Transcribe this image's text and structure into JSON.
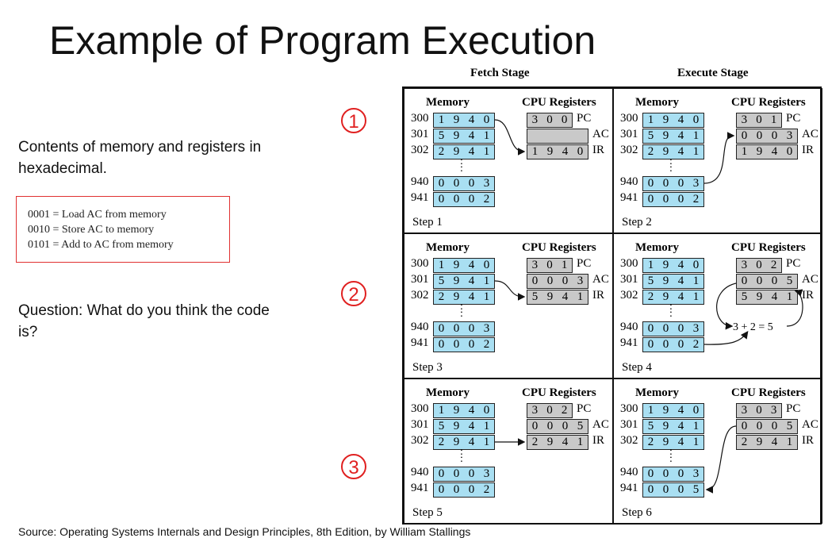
{
  "title": "Example of Program Execution",
  "left": {
    "description": "Contents of memory and registers in hexadecimal.",
    "opcodes": [
      "0001 = Load AC from memory",
      "0010 = Store AC to memory",
      "0101 = Add to AC from memory"
    ],
    "question": "Question: What do you think the code is?"
  },
  "markers": [
    "1",
    "2",
    "3"
  ],
  "marker_color": "#e02020",
  "stages": {
    "fetch": "Fetch Stage",
    "execute": "Execute Stage"
  },
  "labels": {
    "memory": "Memory",
    "cpu": "CPU Registers",
    "pc": "PC",
    "ac": "AC",
    "ir": "IR",
    "dots": ":"
  },
  "colors": {
    "memory": "#a9dff2",
    "register": "#c9c9c9"
  },
  "steps": [
    {
      "label": "Step 1",
      "mem": [
        [
          "300",
          "1940"
        ],
        [
          "301",
          "5941"
        ],
        [
          "302",
          "2941"
        ],
        [
          "940",
          "0003"
        ],
        [
          "941",
          "0002"
        ]
      ],
      "pc": "300",
      "ac": "",
      "ir": "1940"
    },
    {
      "label": "Step 2",
      "mem": [
        [
          "300",
          "1940"
        ],
        [
          "301",
          "5941"
        ],
        [
          "302",
          "2941"
        ],
        [
          "940",
          "0003"
        ],
        [
          "941",
          "0002"
        ]
      ],
      "pc": "301",
      "ac": "0003",
      "ir": "1940"
    },
    {
      "label": "Step 3",
      "mem": [
        [
          "300",
          "1940"
        ],
        [
          "301",
          "5941"
        ],
        [
          "302",
          "2941"
        ],
        [
          "940",
          "0003"
        ],
        [
          "941",
          "0002"
        ]
      ],
      "pc": "301",
      "ac": "0003",
      "ir": "5941"
    },
    {
      "label": "Step 4",
      "mem": [
        [
          "300",
          "1940"
        ],
        [
          "301",
          "5941"
        ],
        [
          "302",
          "2941"
        ],
        [
          "940",
          "0003"
        ],
        [
          "941",
          "0002"
        ]
      ],
      "pc": "302",
      "ac": "0005",
      "ir": "5941",
      "calc": "3 + 2 = 5"
    },
    {
      "label": "Step 5",
      "mem": [
        [
          "300",
          "1940"
        ],
        [
          "301",
          "5941"
        ],
        [
          "302",
          "2941"
        ],
        [
          "940",
          "0003"
        ],
        [
          "941",
          "0002"
        ]
      ],
      "pc": "302",
      "ac": "0005",
      "ir": "2941"
    },
    {
      "label": "Step 6",
      "mem": [
        [
          "300",
          "1940"
        ],
        [
          "301",
          "5941"
        ],
        [
          "302",
          "2941"
        ],
        [
          "940",
          "0003"
        ],
        [
          "941",
          "0005"
        ]
      ],
      "pc": "303",
      "ac": "0005",
      "ir": "2941"
    }
  ],
  "source": "Source: Operating Systems Internals and Design Principles, 8th Edition, by William Stallings"
}
